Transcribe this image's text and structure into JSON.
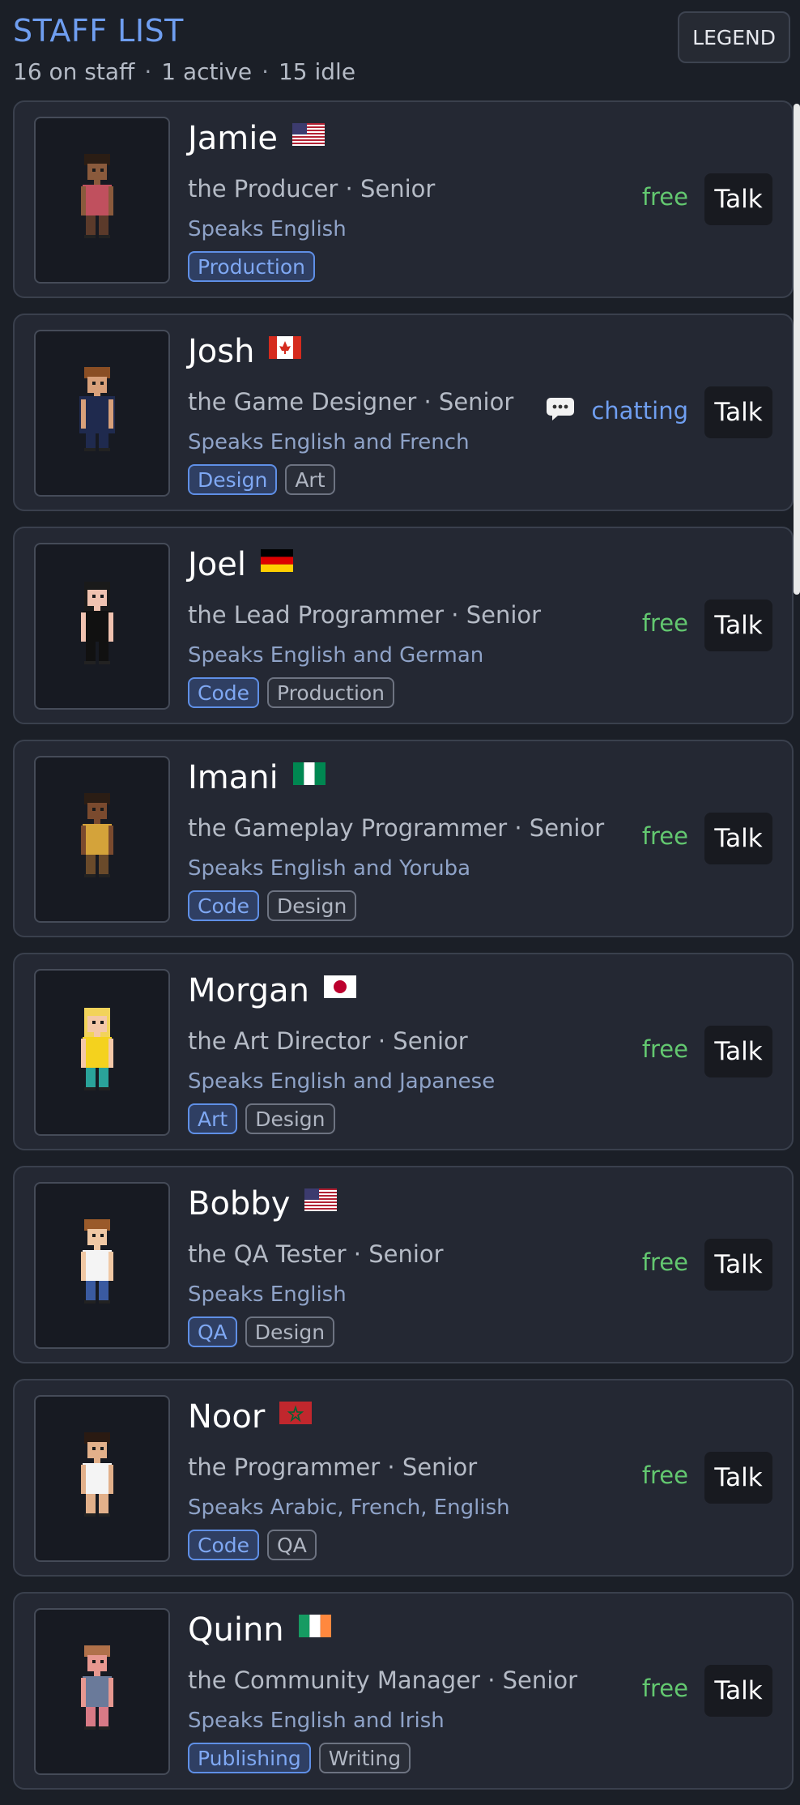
{
  "header": {
    "title": "STAFF LIST",
    "on_staff": "16 on staff",
    "active": "1 active",
    "idle": "15 idle",
    "separator": "·",
    "legend_label": "LEGEND"
  },
  "staff": [
    {
      "name": "Jamie",
      "flag": "us",
      "role": "the Producer · Senior",
      "speaks": "Speaks English",
      "tags": [
        "Production"
      ],
      "status": "free",
      "status_icon": "",
      "talk_label": "Talk"
    },
    {
      "name": "Josh",
      "flag": "ca",
      "role": "the Game Designer · Senior",
      "speaks": "Speaks English and French",
      "tags": [
        "Design",
        "Art"
      ],
      "status": "chatting",
      "status_icon": "speech-bubble-icon",
      "talk_label": "Talk"
    },
    {
      "name": "Joel",
      "flag": "de",
      "role": "the Lead Programmer · Senior",
      "speaks": "Speaks English and German",
      "tags": [
        "Code",
        "Production"
      ],
      "status": "free",
      "status_icon": "",
      "talk_label": "Talk"
    },
    {
      "name": "Imani",
      "flag": "ng",
      "role": "the Gameplay Programmer · Senior",
      "speaks": "Speaks English and Yoruba",
      "tags": [
        "Code",
        "Design"
      ],
      "status": "free",
      "status_icon": "",
      "talk_label": "Talk"
    },
    {
      "name": "Morgan",
      "flag": "jp",
      "role": "the Art Director · Senior",
      "speaks": "Speaks English and Japanese",
      "tags": [
        "Art",
        "Design"
      ],
      "status": "free",
      "status_icon": "",
      "talk_label": "Talk"
    },
    {
      "name": "Bobby",
      "flag": "us",
      "role": "the QA Tester · Senior",
      "speaks": "Speaks English",
      "tags": [
        "QA",
        "Design"
      ],
      "status": "free",
      "status_icon": "",
      "talk_label": "Talk"
    },
    {
      "name": "Noor",
      "flag": "ma",
      "role": "the Programmer · Senior",
      "speaks": "Speaks Arabic, French, English",
      "tags": [
        "Code",
        "QA"
      ],
      "status": "free",
      "status_icon": "",
      "talk_label": "Talk"
    },
    {
      "name": "Quinn",
      "flag": "ie",
      "role": "the Community Manager · Senior",
      "speaks": "Speaks English and Irish",
      "tags": [
        "Publishing",
        "Writing"
      ],
      "status": "free",
      "status_icon": "",
      "talk_label": "Talk"
    }
  ],
  "colors": {
    "accent": "#6f9ef0",
    "free": "#63c870",
    "chatting": "#6f9ef0"
  }
}
